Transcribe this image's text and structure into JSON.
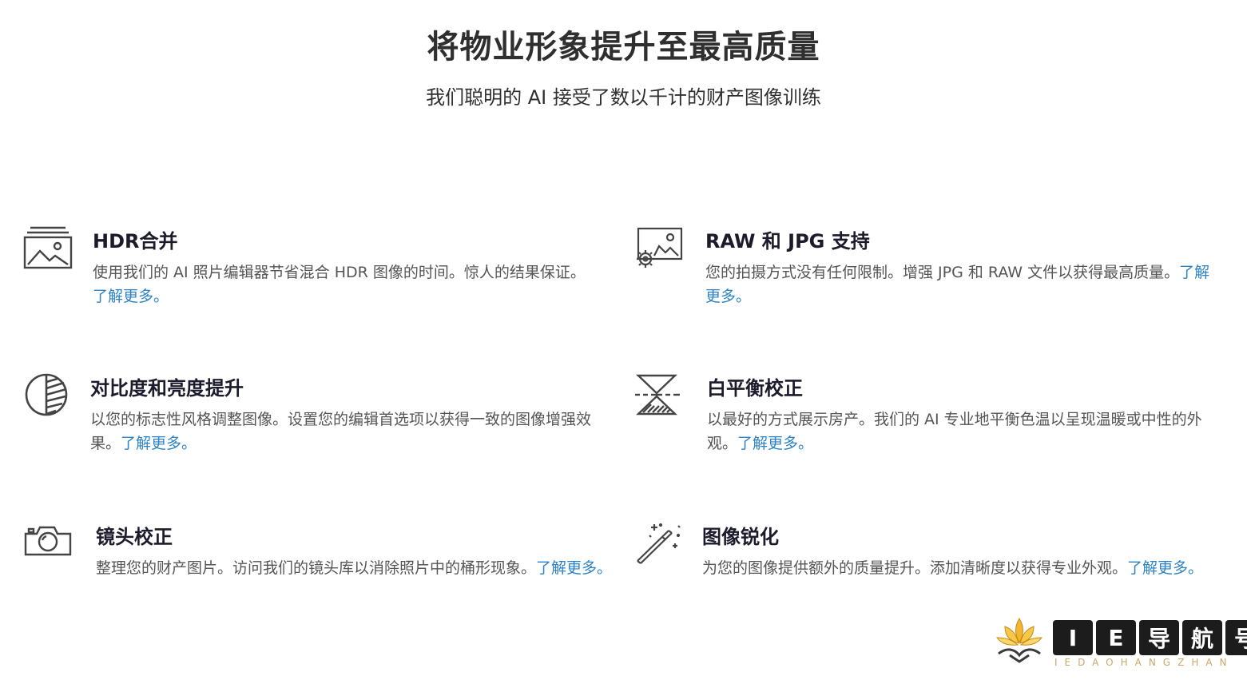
{
  "hero": {
    "title": "将物业形象提升至最高质量",
    "subtitle": "我们聪明的 AI 接受了数以千计的财产图像训练"
  },
  "features": [
    {
      "id": "hdr",
      "icon": "photo-stack-icon",
      "title": "HDR合并",
      "desc": "使用我们的 AI 照片编辑器节省混合 HDR 图像的时间。惊人的结果保证。 ",
      "link": "了解更多。"
    },
    {
      "id": "raw",
      "icon": "photo-gear-icon",
      "title": "RAW 和 JPG 支持",
      "desc": "您的拍摄方式没有任何限制。增强 JPG 和 RAW 文件以获得最高质量。",
      "link": "了解更多。"
    },
    {
      "id": "contrast",
      "icon": "contrast-icon",
      "title": "对比度和亮度提升",
      "desc": "以您的标志性风格调整图像。设置您的编辑首选项以获得一致的图像增强效果。",
      "link": "了解更多。"
    },
    {
      "id": "wb",
      "icon": "white-balance-icon",
      "title": "白平衡校正",
      "desc": "以最好的方式展示房产。我们的 AI 专业地平衡色温以呈现温暖或中性的外观。",
      "link": "了解更多。"
    },
    {
      "id": "lens",
      "icon": "camera-icon",
      "title": "镜头校正",
      "desc": "整理您的财产图片。访问我们的镜头库以消除照片中的桶形现象。",
      "link": "了解更多。"
    },
    {
      "id": "sharp",
      "icon": "magic-wand-icon",
      "title": "图像锐化",
      "desc": "为您的图像提供额外的质量提升。添加清晰度以获得专业外观。",
      "link": "了解更多。"
    }
  ],
  "watermark": {
    "chars": [
      "I",
      "E",
      "导",
      "航",
      "号"
    ],
    "sub": "IEDAOHANGZHAN"
  }
}
